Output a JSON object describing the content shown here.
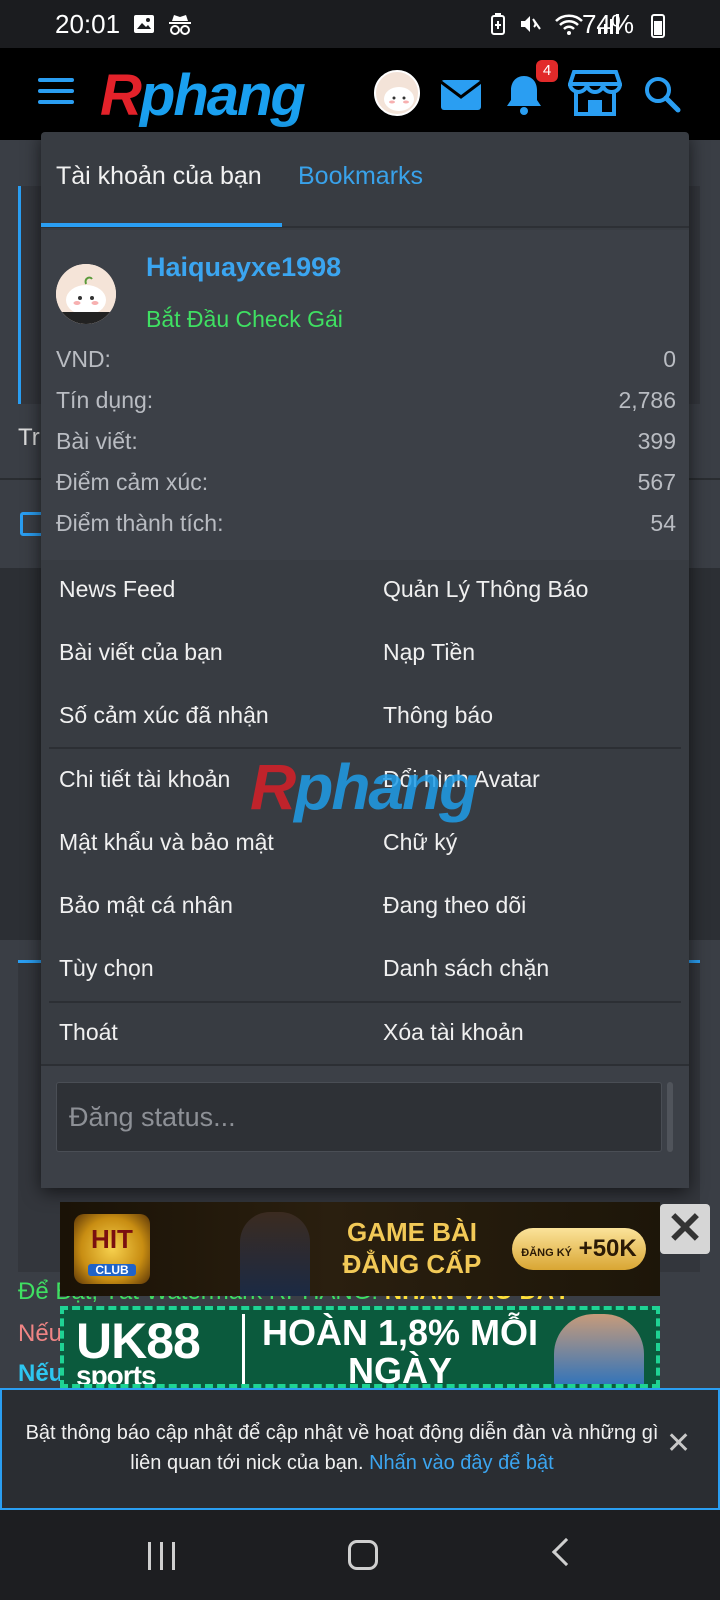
{
  "status_bar": {
    "time": "20:01",
    "battery": "74%",
    "icons": [
      "gallery-icon",
      "incognito-icon",
      "battery-saver-icon",
      "mute-icon",
      "wifi-icon",
      "signal-icon"
    ]
  },
  "header": {
    "logo_r": "R",
    "logo_rest": "phang",
    "notification_count": "4",
    "icons": [
      "menu-icon",
      "mail-icon",
      "bell-icon",
      "store-icon",
      "search-icon"
    ],
    "accent": "#2a9ef2"
  },
  "menu": {
    "tabs": [
      {
        "label": "Tài khoản của bạn",
        "active": true
      },
      {
        "label": "Bookmarks",
        "active": false
      }
    ],
    "profile": {
      "username": "Haiquayxe1998",
      "user_title": "Bắt Đầu Check Gái",
      "stats": [
        {
          "label": "VND:",
          "value": "0"
        },
        {
          "label": "Tín dụng:",
          "value": "2,786"
        },
        {
          "label": "Bài viết:",
          "value": "399"
        },
        {
          "label": "Điểm cảm xúc:",
          "value": "567"
        },
        {
          "label": "Điểm thành tích:",
          "value": "54"
        }
      ]
    },
    "links": {
      "news_feed": "News Feed",
      "manage_notifications": "Quản Lý Thông Báo",
      "your_posts": "Bài viết của bạn",
      "deposit": "Nạp Tiền",
      "reactions_received": "Số cảm xúc đã nhận",
      "alerts": "Thông báo",
      "account_details": "Chi tiết tài khoản",
      "change_avatar": "Đổi hình Avatar",
      "password_security": "Mật khẩu và bảo mật",
      "signature": "Chữ ký",
      "privacy": "Bảo mật cá nhân",
      "following": "Đang theo dõi",
      "preferences": "Tùy chọn",
      "ignored": "Danh sách chặn",
      "logout": "Thoát",
      "delete_account": "Xóa tài khoản"
    },
    "status_placeholder": "Đăng status..."
  },
  "ads": {
    "ad1": {
      "brand": "HIT",
      "brand_sub": "CLUB",
      "title": "GAME BÀI ĐẲNG CẤP",
      "cta_small": "ĐĂNG KÝ",
      "cta": "+50K"
    },
    "ad2": {
      "brand": "UK88",
      "brand_sub": "sports",
      "offer": "HOÀN 1,8% MỖI NGÀY"
    }
  },
  "background": {
    "tr": "Tr",
    "msg1": "Để Bật, Tắt Watermark RPHANG:",
    "msg1_link": "NHẤN VÀO ĐÂY",
    "msg2": "Nếu",
    "msg3": "Nếu"
  },
  "notification_prompt": {
    "text": "Bật thông báo cập nhật để cập nhật về hoạt động diễn đàn và những gì liên quan tới nick của bạn.",
    "link": "Nhấn vào đây để bật"
  }
}
